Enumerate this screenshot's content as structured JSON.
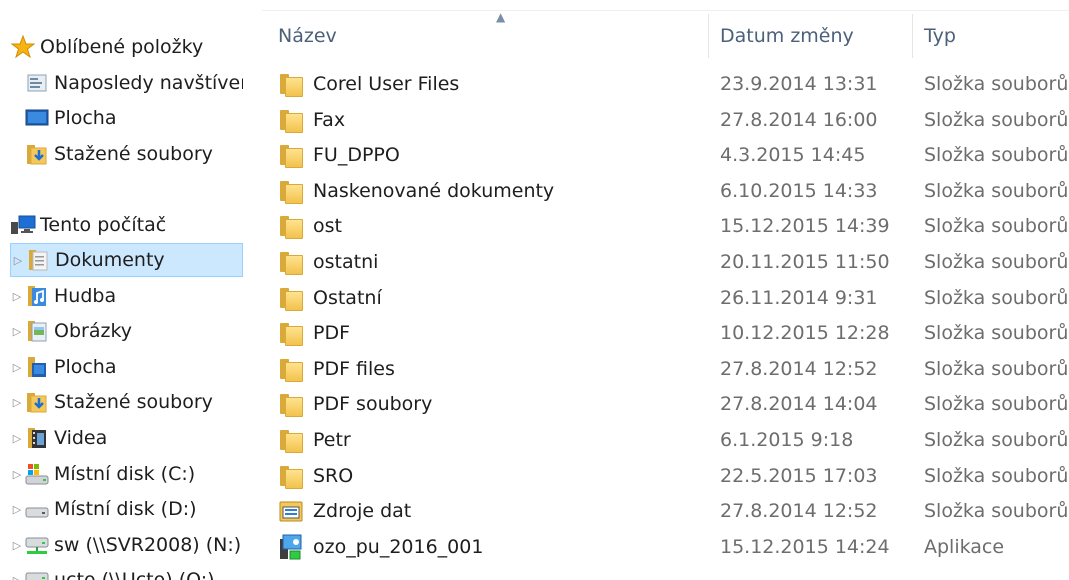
{
  "nav": {
    "favorites": {
      "label": "Oblíbené položky",
      "icon": "star-icon",
      "items": [
        {
          "label": "Naposledy navštívené",
          "icon": "recent-places-icon"
        },
        {
          "label": "Plocha",
          "icon": "desktop-icon"
        },
        {
          "label": "Stažené soubory",
          "icon": "downloads-icon"
        }
      ]
    },
    "computer": {
      "label": "Tento počítač",
      "icon": "computer-icon",
      "items": [
        {
          "label": "Dokumenty",
          "icon": "documents-icon",
          "selected": true
        },
        {
          "label": "Hudba",
          "icon": "music-icon"
        },
        {
          "label": "Obrázky",
          "icon": "pictures-icon"
        },
        {
          "label": "Plocha",
          "icon": "desktop-icon"
        },
        {
          "label": "Stažené soubory",
          "icon": "downloads-icon"
        },
        {
          "label": "Videa",
          "icon": "videos-icon"
        },
        {
          "label": "Místní disk (C:)",
          "icon": "system-drive-icon"
        },
        {
          "label": "Místní disk (D:)",
          "icon": "drive-icon"
        },
        {
          "label": "sw (\\\\SVR2008) (N:)",
          "icon": "network-drive-icon"
        },
        {
          "label": "ucto (\\\\Ucto) (O:)",
          "icon": "network-drive-icon"
        }
      ]
    }
  },
  "columns": {
    "name": "Název",
    "date": "Datum změny",
    "type": "Typ"
  },
  "files": [
    {
      "name": "Corel User Files",
      "date": "23.9.2014 13:31",
      "type": "Složka souborů",
      "icon": "folder-icon"
    },
    {
      "name": "Fax",
      "date": "27.8.2014 16:00",
      "type": "Složka souborů",
      "icon": "folder-icon"
    },
    {
      "name": "FU_DPPO",
      "date": "4.3.2015 14:45",
      "type": "Složka souborů",
      "icon": "folder-icon"
    },
    {
      "name": "Naskenované dokumenty",
      "date": "6.10.2015 14:33",
      "type": "Složka souborů",
      "icon": "folder-icon"
    },
    {
      "name": "ost",
      "date": "15.12.2015 14:39",
      "type": "Složka souborů",
      "icon": "folder-icon"
    },
    {
      "name": "ostatni",
      "date": "20.11.2015 11:50",
      "type": "Složka souborů",
      "icon": "folder-icon"
    },
    {
      "name": "Ostatní",
      "date": "26.11.2014 9:31",
      "type": "Složka souborů",
      "icon": "folder-icon"
    },
    {
      "name": "PDF",
      "date": "10.12.2015 12:28",
      "type": "Složka souborů",
      "icon": "folder-icon"
    },
    {
      "name": "PDF files",
      "date": "27.8.2014 12:52",
      "type": "Složka souborů",
      "icon": "folder-icon"
    },
    {
      "name": "PDF soubory",
      "date": "27.8.2014 14:04",
      "type": "Složka souborů",
      "icon": "folder-icon"
    },
    {
      "name": "Petr",
      "date": "6.1.2015 9:18",
      "type": "Složka souborů",
      "icon": "folder-icon"
    },
    {
      "name": "SRO",
      "date": "22.5.2015 17:03",
      "type": "Složka souborů",
      "icon": "folder-icon"
    },
    {
      "name": "Zdroje dat",
      "date": "27.8.2014 12:52",
      "type": "Složka souborů",
      "icon": "data-sources-folder-icon"
    },
    {
      "name": "ozo_pu_2016_001",
      "date": "15.12.2015 14:24",
      "type": "Aplikace",
      "icon": "application-icon"
    }
  ],
  "colors": {
    "selection_bg": "#cce8ff",
    "selection_border": "#99d1ff",
    "header_text": "#4c607a",
    "secondary_text": "#6d6d6d"
  }
}
